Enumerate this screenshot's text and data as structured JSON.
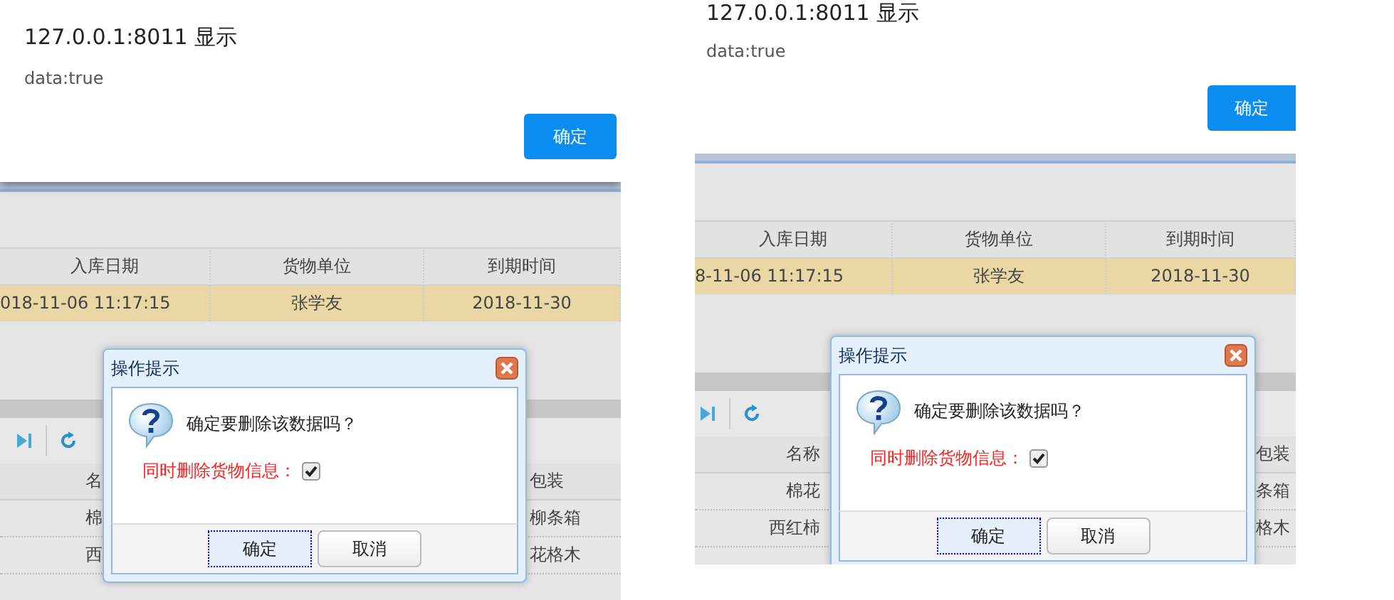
{
  "panels": [
    {
      "kind": "boxed",
      "alert": {
        "title": "127.0.0.1:8011 显示",
        "message": "data:true",
        "button": "确定"
      },
      "grid": {
        "columns": [
          "入库日期",
          "货物单位",
          "到期时间"
        ],
        "rows": [
          {
            "cells": [
              "018-11-06 11:17:15",
              "张学友",
              "2018-11-30"
            ],
            "selected": true
          }
        ]
      },
      "lower_grid": {
        "columns": [
          "名",
          "包装"
        ],
        "rows": [
          {
            "cells": [
              "棉",
              "柳条箱"
            ]
          },
          {
            "cells": [
              "西",
              "花格木"
            ]
          }
        ]
      },
      "dialog": {
        "title": "操作提示",
        "message": "确定要删除该数据吗？",
        "option": {
          "label": "同时删除货物信息：",
          "checked": true
        },
        "buttons": [
          {
            "label": "确定",
            "focused": true
          },
          {
            "label": "取消",
            "focused": false
          }
        ]
      }
    },
    {
      "kind": "flat",
      "alert": {
        "title": "127.0.0.1:8011 显示",
        "message": "data:true",
        "button": "确定"
      },
      "grid": {
        "columns": [
          "入库日期",
          "货物单位",
          "到期时间"
        ],
        "rows": [
          {
            "cells": [
              "8-11-06 11:17:15",
              "张学友",
              "2018-11-30"
            ],
            "selected": true
          }
        ]
      },
      "lower_grid": {
        "columns": [
          "名称",
          "包装"
        ],
        "rows": [
          {
            "cells": [
              "棉花",
              "条箱"
            ]
          },
          {
            "cells": [
              "西红柿",
              "格木"
            ]
          }
        ]
      },
      "dialog": {
        "title": "操作提示",
        "message": "确定要删除该数据吗？",
        "option": {
          "label": "同时删除货物信息：",
          "checked": true
        },
        "buttons": [
          {
            "label": "确定",
            "focused": true
          },
          {
            "label": "取消",
            "focused": false
          }
        ]
      }
    }
  ]
}
